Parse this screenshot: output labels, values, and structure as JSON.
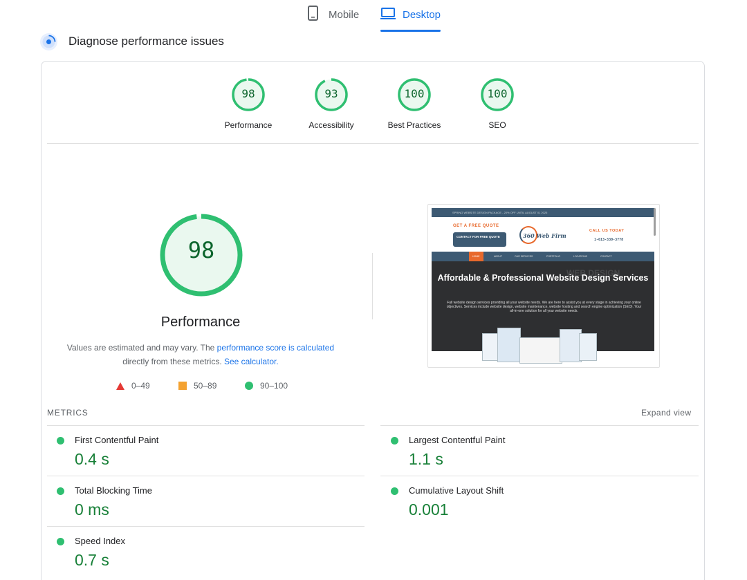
{
  "tabs": [
    {
      "label": "Mobile",
      "icon": "smartphone-icon"
    },
    {
      "label": "Desktop",
      "icon": "laptop-icon",
      "selected": true
    }
  ],
  "diagnose": {
    "title": "Diagnose performance issues",
    "icon": "diagnose-icon"
  },
  "scores": [
    {
      "label": "Performance",
      "value": "98",
      "score": 98
    },
    {
      "label": "Accessibility",
      "value": "93",
      "score": 93
    },
    {
      "label": "Best Practices",
      "value": "100",
      "score": 100
    },
    {
      "label": "SEO",
      "value": "100",
      "score": 100
    }
  ],
  "main_gauge": {
    "value": "98",
    "score": 98,
    "label": "Performance"
  },
  "note": {
    "text1": "Values are estimated and may vary. The ",
    "link1": "performance score is calculated",
    "text2": "directly from these metrics. ",
    "link2": "See calculator."
  },
  "legend": [
    {
      "shape": "triangle",
      "range": "0–49",
      "color": "#e53935"
    },
    {
      "shape": "square",
      "range": "50–89",
      "color": "#f4a230"
    },
    {
      "shape": "circle",
      "range": "90–100",
      "color": "#2fbf71"
    }
  ],
  "screenshot": {
    "top_bar": "SPRING WEBSITE DESIGN PACKAGE - 20% OFF UNTIL AUGUST 01 2025",
    "quote_label": "GET A FREE QUOTE",
    "contact_button": "CONTACT FOR FREE QUOTE",
    "logo": "360 Web Firm",
    "call_label": "CALL US TODAY",
    "phone": "1-613-330-3778",
    "nav": [
      "HOME",
      "ABOUT",
      "OUR SERVICES",
      "PORTFOLIO",
      "LOCATIONS",
      "CONTACT"
    ],
    "hero_title": "Affordable & Professional Website Design Services",
    "hero_text": "Full website design services providing all your website needs. We are here to assist you at every stage in achieving your online objectives. Services include website design, website maintenance, website hosting and search engine optimization (SEO). Your all-in-one solution for all your website needs.",
    "hero_watermark": "WEB DESIGN"
  },
  "metrics": {
    "header": "METRICS",
    "expand_label": "Expand view",
    "items": [
      {
        "name": "First Contentful Paint",
        "value": "0.4 s",
        "status": "good"
      },
      {
        "name": "Largest Contentful Paint",
        "value": "1.1 s",
        "status": "good"
      },
      {
        "name": "Total Blocking Time",
        "value": "0 ms",
        "status": "good"
      },
      {
        "name": "Cumulative Layout Shift",
        "value": "0.001",
        "status": "good"
      },
      {
        "name": "Speed Index",
        "value": "0.7 s",
        "status": "good"
      }
    ]
  },
  "colors": {
    "accent": "#1a73e8",
    "pass": "#0cce6b",
    "pass_text": "#0d652d",
    "pass_fill": "#eaf8ef"
  }
}
